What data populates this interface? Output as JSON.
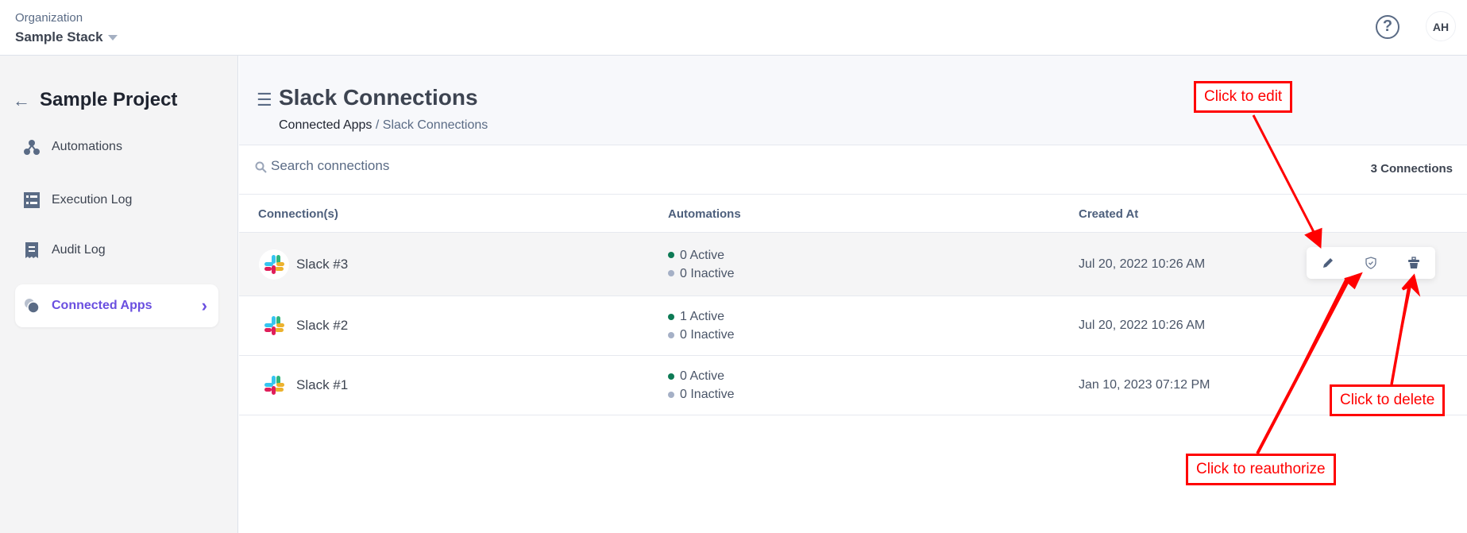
{
  "topbar": {
    "org_label": "Organization",
    "org_name": "Sample Stack",
    "help": "?",
    "avatar": "AH"
  },
  "sidebar": {
    "back_icon": "arrow-left-icon",
    "project": "Sample Project",
    "items": [
      {
        "label": "Automations",
        "icon": "automation-nodes-icon"
      },
      {
        "label": "Execution Log",
        "icon": "list-icon"
      },
      {
        "label": "Audit Log",
        "icon": "receipt-icon"
      },
      {
        "label": "Connected Apps",
        "icon": "connected-apps-icon",
        "active": true
      }
    ]
  },
  "page": {
    "title": "Slack Connections",
    "breadcrumb": {
      "parent": "Connected Apps",
      "sep": " / ",
      "current": "Slack Connections"
    }
  },
  "search": {
    "placeholder": "Search connections",
    "value": "",
    "count": "3 Connections"
  },
  "table": {
    "columns": [
      "Connection(s)",
      "Automations",
      "Created At"
    ],
    "rows": [
      {
        "name": "Slack #3",
        "active": "0 Active",
        "inactive": "0 Inactive",
        "created": "Jul 20, 2022 10:26 AM"
      },
      {
        "name": "Slack #2",
        "active": "1 Active",
        "inactive": "0 Inactive",
        "created": "Jul 20, 2022 10:26 AM"
      },
      {
        "name": "Slack #1",
        "active": "0 Active",
        "inactive": "0 Inactive",
        "created": "Jan 10, 2023 07:12 PM"
      }
    ]
  },
  "annotations": {
    "edit": "Click to edit",
    "reauthorize": "Click to reauthorize",
    "delete": "Click to delete"
  },
  "colors": {
    "accent": "#6a4fe0",
    "active_dot": "#0d7a55",
    "inactive_dot": "#a5b0c6",
    "annotation": "#ff0000"
  }
}
